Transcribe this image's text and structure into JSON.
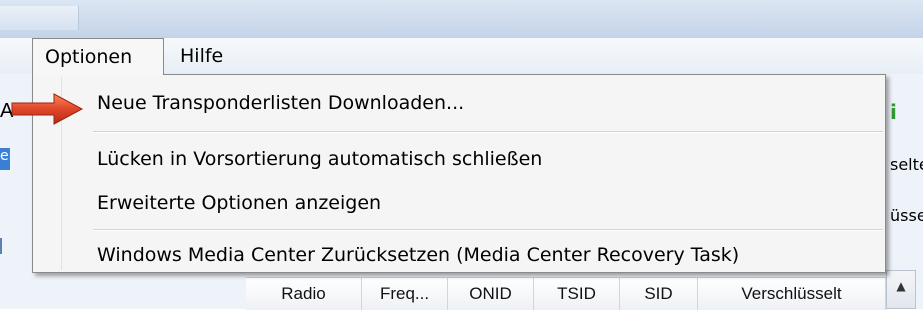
{
  "menubar": {
    "optionen": "Optionen",
    "hilfe": "Hilfe"
  },
  "dropdown": {
    "items": [
      "Neue Transponderlisten Downloaden...",
      "Lücken in Vorsortierung automatisch schließen",
      "Erweiterte Optionen anzeigen",
      "Windows Media Center Zurücksetzen (Media Center Recovery Task)"
    ]
  },
  "background": {
    "left_letter": "A",
    "left_blue_text": "ei",
    "right_green": "i",
    "right_text_1": "selte",
    "right_text_2": "üsse"
  },
  "table": {
    "headers": [
      "Radio",
      "Freq...",
      "ONID",
      "TSID",
      "SID",
      "Verschlüsselt"
    ]
  },
  "colors": {
    "arrow": "#e0462a",
    "menu_bg": "#f5f5f5",
    "selection_blue": "#3b7fd4"
  }
}
